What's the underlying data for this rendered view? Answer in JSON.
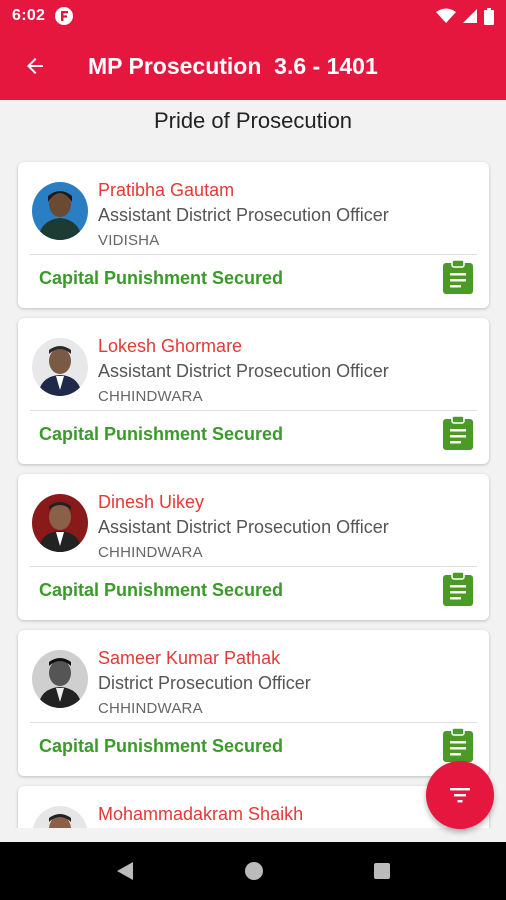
{
  "status_bar": {
    "time": "6:02"
  },
  "app_bar": {
    "title": "MP Prosecution  3.6 - 1401"
  },
  "subtitle": "Pride of Prosecution",
  "cards": [
    {
      "name": "Pratibha Gautam",
      "role": "Assistant District Prosecution Officer",
      "district": "VIDISHA",
      "status": "Capital Punishment Secured"
    },
    {
      "name": "Lokesh Ghormare",
      "role": "Assistant District Prosecution Officer",
      "district": "CHHINDWARA",
      "status": "Capital Punishment Secured"
    },
    {
      "name": "Dinesh Uikey",
      "role": "Assistant District Prosecution Officer",
      "district": "CHHINDWARA",
      "status": "Capital Punishment Secured"
    },
    {
      "name": "Sameer Kumar Pathak",
      "role": "District Prosecution Officer",
      "district": "CHHINDWARA",
      "status": "Capital Punishment Secured"
    },
    {
      "name": "Mohammadakram Shaikh",
      "role": "",
      "district": "",
      "status": ""
    }
  ],
  "colors": {
    "primary": "#e5173f",
    "name_red": "#e53935",
    "status_green": "#3a9a2a"
  },
  "icons": {
    "back": "arrow-left-icon",
    "clipboard": "clipboard-icon",
    "filter": "filter-icon"
  }
}
